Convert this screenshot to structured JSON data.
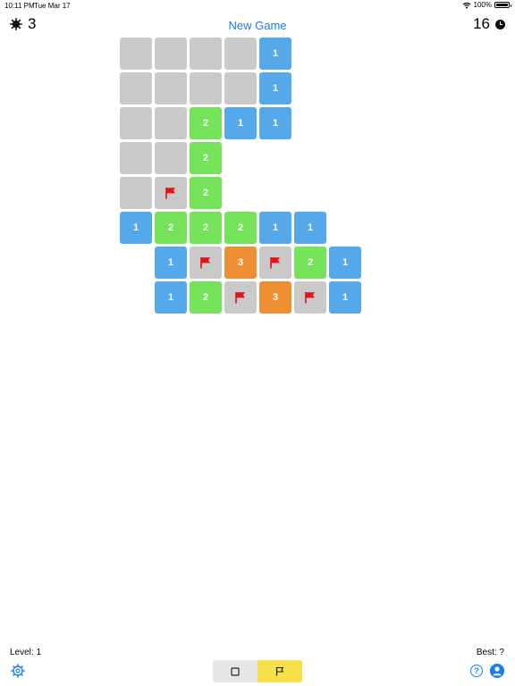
{
  "status_bar": {
    "time": "10:11 PM",
    "date": "Tue Mar 17",
    "battery": "100%",
    "wifi_icon": "wifi-icon",
    "battery_icon": "battery-icon"
  },
  "header": {
    "mines_remaining": "3",
    "mine_icon": "mine-icon",
    "new_game_label": "New Game",
    "timer": "16",
    "clock_icon": "clock-icon"
  },
  "colors": {
    "accent": "#1a7df0",
    "hidden": "#c9c9c9",
    "one": "#55a8ea",
    "two": "#74e35a",
    "three": "#ee8f34",
    "flag": "#ee1111",
    "flag_mode_active": "#f7e04a"
  },
  "board": {
    "rows": [
      [
        "H",
        "H",
        "H",
        "H",
        "1",
        null,
        null
      ],
      [
        "H",
        "H",
        "H",
        "H",
        "1",
        null,
        null
      ],
      [
        "H",
        "H",
        "2",
        "1",
        "1",
        null,
        null
      ],
      [
        "H",
        "H",
        "2",
        null,
        null,
        null,
        null
      ],
      [
        "H",
        "F",
        "2",
        null,
        null,
        null,
        null
      ],
      [
        "1",
        "2",
        "2",
        "2",
        "1",
        "1",
        null
      ],
      [
        null,
        "1",
        "F",
        "3",
        "F",
        "2",
        "1"
      ],
      [
        null,
        "1",
        "2",
        "F",
        "3",
        "F",
        "1"
      ]
    ]
  },
  "footer": {
    "level": "Level: 1",
    "best": "Best: ?",
    "settings_icon": "gear-icon",
    "mode_options": [
      {
        "name": "reveal",
        "icon": "square-icon",
        "active": false
      },
      {
        "name": "flag",
        "icon": "flag-icon",
        "active": true
      }
    ],
    "help_icon": "question-icon",
    "help_glyph": "?",
    "account_icon": "person-icon"
  }
}
